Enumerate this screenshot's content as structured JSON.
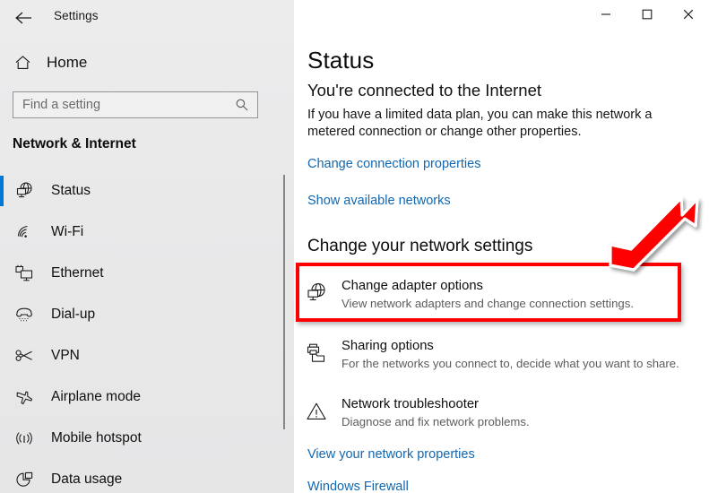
{
  "window": {
    "title": "Settings",
    "back_icon": "back-arrow-icon",
    "controls": [
      {
        "name": "minimize",
        "glyph": "minimize-icon",
        "label": "Minimize"
      },
      {
        "name": "maximize",
        "glyph": "maximize-icon",
        "label": "Maximize"
      },
      {
        "name": "close",
        "glyph": "close-icon",
        "label": "Close"
      }
    ]
  },
  "sidebar": {
    "home_label": "Home",
    "home_icon": "home-icon",
    "search": {
      "placeholder": "Find a setting",
      "value": "",
      "icon": "search-icon"
    },
    "section_title": "Network & Internet",
    "selected_index": 0,
    "items": [
      {
        "label": "Status",
        "icon": "status-globe-icon",
        "selected": true
      },
      {
        "label": "Wi-Fi",
        "icon": "wifi-icon",
        "selected": false
      },
      {
        "label": "Ethernet",
        "icon": "ethernet-icon",
        "selected": false
      },
      {
        "label": "Dial-up",
        "icon": "dialup-phone-icon",
        "selected": false
      },
      {
        "label": "VPN",
        "icon": "vpn-key-icon",
        "selected": false
      },
      {
        "label": "Airplane mode",
        "icon": "airplane-icon",
        "selected": false
      },
      {
        "label": "Mobile hotspot",
        "icon": "hotspot-signal-icon",
        "selected": false
      },
      {
        "label": "Data usage",
        "icon": "data-usage-pie-icon",
        "selected": false
      }
    ],
    "scrollbar": "vertical-scrollbar"
  },
  "main": {
    "page_title": "Status",
    "connection_status": "You're connected to the Internet",
    "description": "If you have a limited data plan, you can make this network a metered connection or change other properties.",
    "link_change_connection": "Change connection properties",
    "link_show_networks": "Show available networks",
    "settings_heading": "Change your network settings",
    "options": [
      {
        "title": "Change adapter options",
        "subtitle": "View network adapters and change connection settings.",
        "icon": "adapter-globe-icon",
        "highlighted": true
      },
      {
        "title": "Sharing options",
        "subtitle": "For the networks you connect to, decide what you want to share.",
        "icon": "sharing-printer-folder-icon",
        "highlighted": false
      },
      {
        "title": "Network troubleshooter",
        "subtitle": "Diagnose and fix network problems.",
        "icon": "warning-triangle-icon",
        "highlighted": false
      }
    ],
    "link_view_properties": "View your network properties",
    "link_windows_firewall": "Windows Firewall"
  },
  "annotations": {
    "highlight_color": "#ff0000",
    "highlight_target": "Change adapter options",
    "arrow_color": "#ff0000",
    "arrow_direction": "down-left",
    "arrow_name": "red-pointer-arrow"
  },
  "colors": {
    "accent": "#0078d7",
    "link": "#1267b1",
    "sidebar_bg": "#eaeaeb",
    "content_bg": "#ffffff",
    "annotation_red": "#ff0000"
  }
}
